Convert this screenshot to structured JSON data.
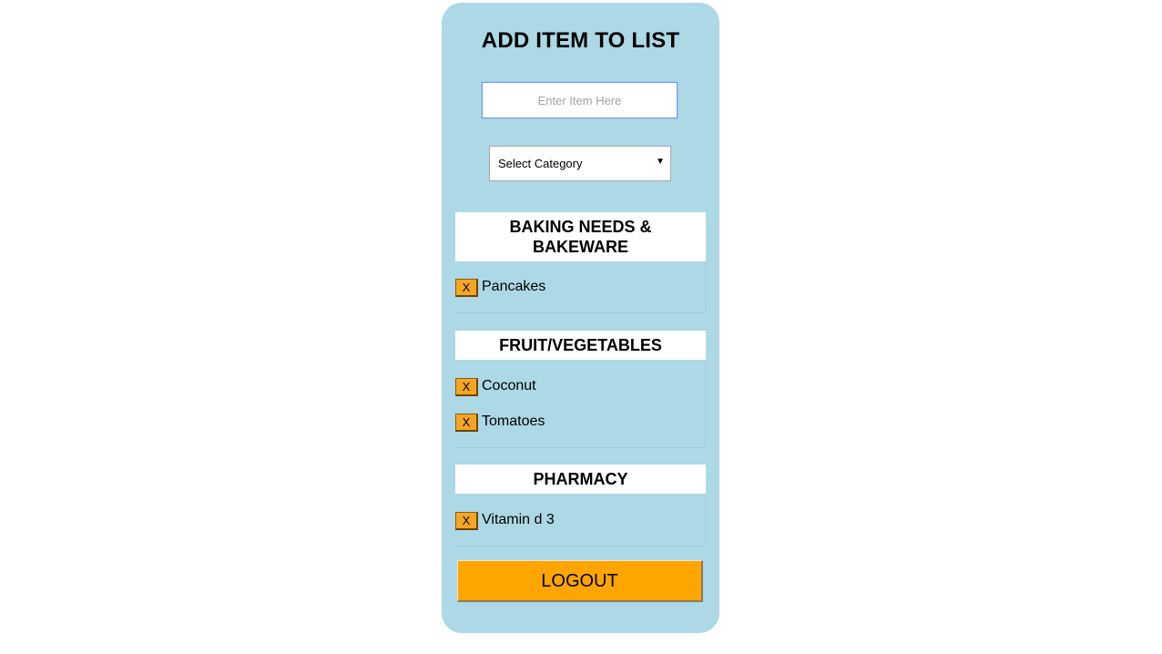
{
  "form": {
    "title": "ADD ITEM TO LIST",
    "item_input_placeholder": "Enter Item Here",
    "item_input_value": "",
    "category_select_value": "Select Category"
  },
  "categories": [
    {
      "name_line1": "BAKING NEEDS &",
      "name_line2": "BAKEWARE",
      "items": [
        {
          "delete_label": "X",
          "label": "Pancakes"
        }
      ]
    },
    {
      "name": "FRUIT/VEGETABLES",
      "items": [
        {
          "delete_label": "X",
          "label": "Coconut"
        },
        {
          "delete_label": "X",
          "label": "Tomatoes"
        }
      ]
    },
    {
      "name": "PHARMACY",
      "items": [
        {
          "delete_label": "X",
          "label": "Vitamin d 3"
        }
      ]
    }
  ],
  "logout_label": "LOGOUT",
  "colors": {
    "panel_background": "#add8e6",
    "delete_button": "#f4a623",
    "logout_button": "#ffa500"
  },
  "icons": {
    "select_arrow": "dropdown-triangle-icon"
  }
}
